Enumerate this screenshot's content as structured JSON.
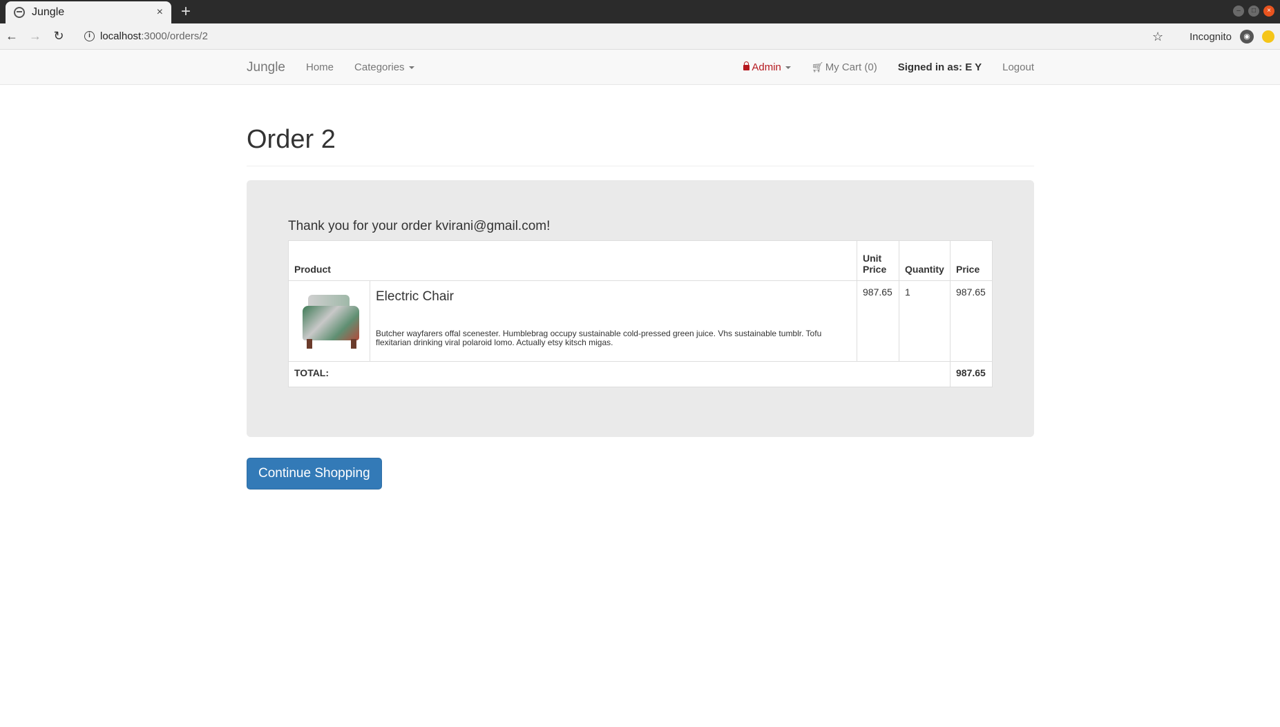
{
  "browser": {
    "tab_title": "Jungle",
    "tab_close": "×",
    "new_tab": "+",
    "url_host": "localhost",
    "url_path": ":3000/orders/2",
    "profile_label": "Incognito"
  },
  "navbar": {
    "brand": "Jungle",
    "home": "Home",
    "categories": "Categories",
    "admin": "Admin",
    "cart": "My Cart (0)",
    "signed_in": "Signed in as: E Y",
    "logout": "Logout"
  },
  "page": {
    "title": "Order 2",
    "thanks": "Thank you for your order kvirani@gmail.com!",
    "continue_button": "Continue Shopping"
  },
  "table": {
    "headers": {
      "product": "Product",
      "unit_price": "Unit Price",
      "quantity": "Quantity",
      "price": "Price"
    },
    "items": [
      {
        "name": "Electric Chair",
        "description": "Butcher wayfarers offal scenester. Humblebrag occupy sustainable cold-pressed green juice. Vhs sustainable tumblr. Tofu flexitarian drinking viral polaroid lomo. Actually etsy kitsch migas.",
        "unit_price": "987.65",
        "quantity": "1",
        "price": "987.65"
      }
    ],
    "total_label": "TOTAL:",
    "total_value": "987.65"
  },
  "icons": {
    "back": "back-arrow-icon",
    "forward": "forward-arrow-icon",
    "reload": "reload-icon",
    "info": "info-icon",
    "star": "bookmark-star-icon",
    "incognito": "incognito-icon",
    "lock": "lock-icon",
    "cart": "cart-icon"
  },
  "colors": {
    "primary_button": "#337ab7",
    "admin_link": "#b5191f",
    "jumbotron_bg": "#eaeaea"
  }
}
